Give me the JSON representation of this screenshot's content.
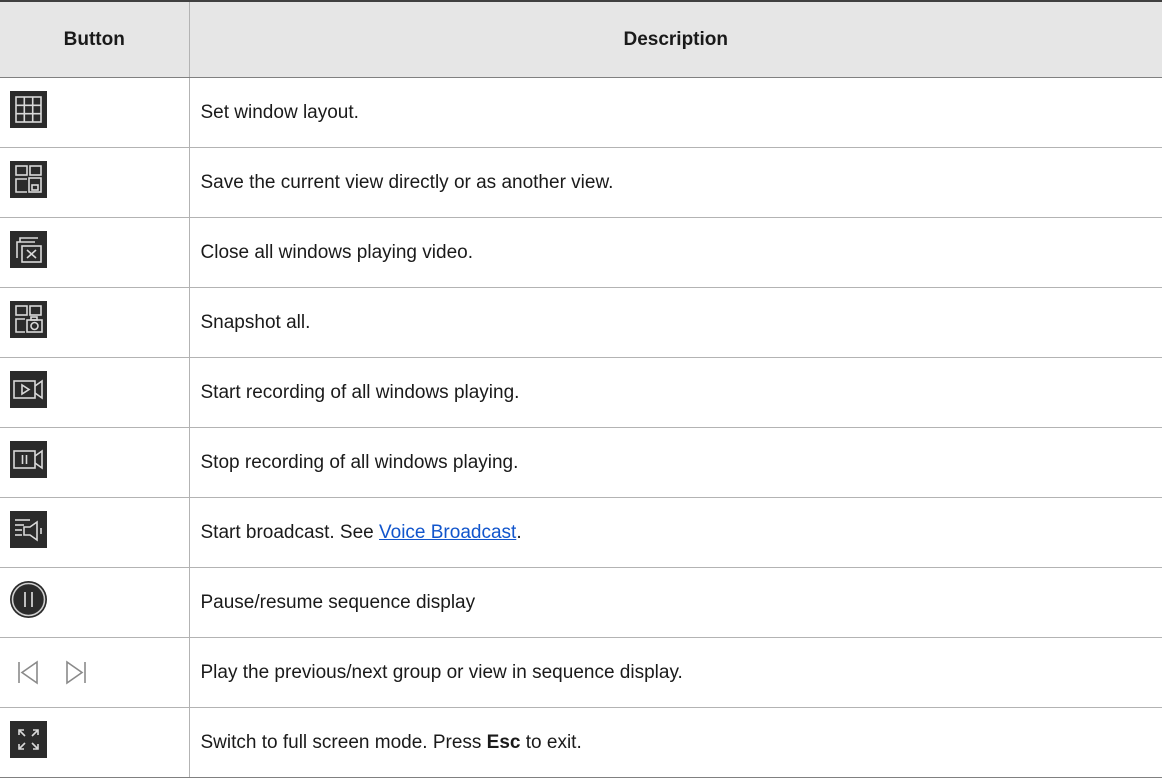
{
  "header": {
    "button": "Button",
    "description": "Description"
  },
  "rows": [
    {
      "icon": "window-layout-icon",
      "text": "Set window layout."
    },
    {
      "icon": "save-view-icon",
      "text": "Save the current view directly or as another view."
    },
    {
      "icon": "close-all-windows-icon",
      "text": "Close all windows playing video."
    },
    {
      "icon": "snapshot-all-icon",
      "text": "Snapshot all."
    },
    {
      "icon": "start-recording-icon",
      "text": "Start recording of all windows playing."
    },
    {
      "icon": "stop-recording-icon",
      "text": "Stop recording of all windows playing."
    },
    {
      "icon": "broadcast-icon",
      "text_before": "Start broadcast. See ",
      "link": "Voice Broadcast",
      "text_after": "."
    },
    {
      "icon": "pause-resume-icon",
      "text": "Pause/resume sequence display"
    },
    {
      "icons": [
        "previous-icon",
        "next-icon"
      ],
      "text": "Play the previous/next group or view in sequence display."
    },
    {
      "icon": "full-screen-icon",
      "text_before": "Switch to full screen mode. Press ",
      "bold": "Esc",
      "text_after": " to exit."
    }
  ],
  "colors": {
    "icon_bg": "#2b2b2b",
    "icon_stroke": "#d9d9d9",
    "header_bg": "#e6e6e6",
    "link": "#1155cc"
  }
}
